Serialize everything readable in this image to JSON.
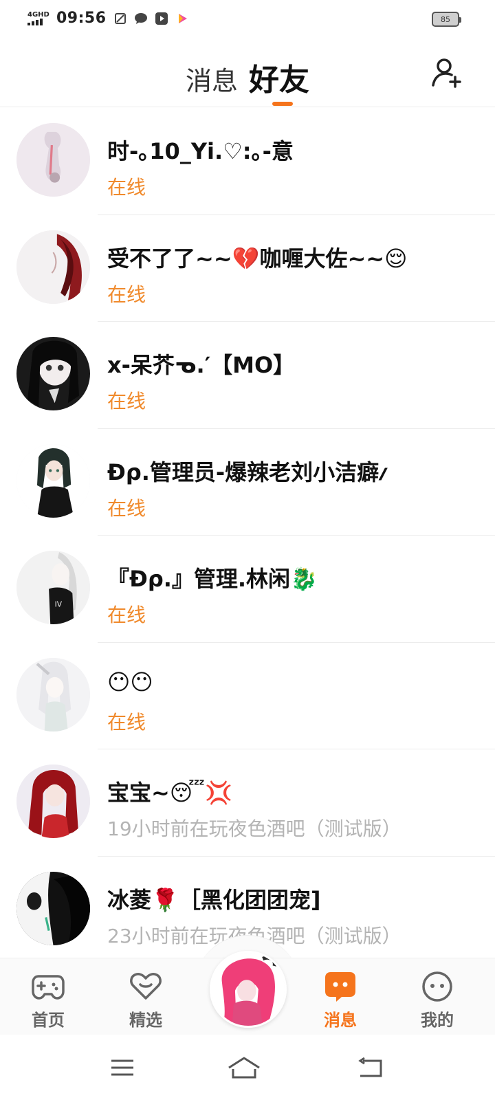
{
  "status_bar": {
    "network": "4GHD",
    "time": "09:56",
    "battery": "85"
  },
  "header": {
    "tabs": [
      {
        "label": "消息",
        "active": false
      },
      {
        "label": "好友",
        "active": true
      }
    ],
    "accent_color": "#f5741c",
    "add_friend_icon": "add-user-icon"
  },
  "friends": [
    {
      "name": "时-｡10_Yi.♡:｡-意",
      "status": "在线",
      "online": true
    },
    {
      "name": "受不了了~~💔咖喱大佐~~😌",
      "status": "在线",
      "online": true
    },
    {
      "name": "x-呆芥ᓀ.′【MO】",
      "status": "在线",
      "online": true
    },
    {
      "name": "Ɖρ.管理员-爆辣老刘小洁癖ⳇ",
      "status": "在线",
      "online": true
    },
    {
      "name": "『Ɖρ.』管理.林闲🐉",
      "status": "在线",
      "online": true
    },
    {
      "name": "😶😶",
      "status": "在线",
      "online": true
    },
    {
      "name": "宝宝~😴💢",
      "status": "19小时前在玩夜色酒吧（测试版）",
      "online": false
    },
    {
      "name": "冰菱🌹［黑化团团宠]",
      "status": "23小时前在玩夜色酒吧（测试版）",
      "online": false
    }
  ],
  "bottom_nav": {
    "items": [
      {
        "label": "首页",
        "icon": "gamepad-icon",
        "active": false
      },
      {
        "label": "精选",
        "icon": "heart-icon",
        "active": false
      },
      {
        "label": "消息",
        "icon": "chat-bubble-icon",
        "active": true
      },
      {
        "label": "我的",
        "icon": "face-icon",
        "active": false
      }
    ]
  },
  "colors": {
    "online": "#f08a2c",
    "offline": "#b4b4b4",
    "accent": "#f5741c"
  }
}
